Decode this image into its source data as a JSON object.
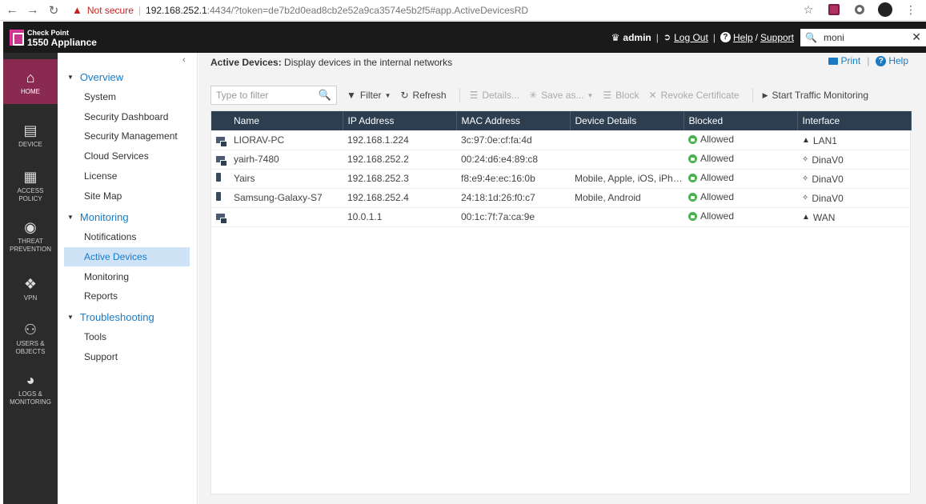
{
  "browser": {
    "security_label": "Not secure",
    "url_host": "192.168.252.1",
    "url_rest": ":4434/?token=de7b2d0ead8cb2e52a9ca3574e5b2f5#app.ActiveDevicesRD"
  },
  "header": {
    "brand_top": "Check Point",
    "brand_bottom": "1550 Appliance",
    "user": "admin",
    "logout": "Log Out",
    "help": "Help",
    "slash": "/",
    "support": "Support",
    "search_value": "moni"
  },
  "icon_nav": [
    {
      "label1": "HOME",
      "label2": "",
      "icon": "home-icon"
    },
    {
      "label1": "DEVICE",
      "label2": "",
      "icon": "device-icon"
    },
    {
      "label1": "ACCESS",
      "label2": "POLICY",
      "icon": "grid-icon"
    },
    {
      "label1": "THREAT",
      "label2": "PREVENTION",
      "icon": "shield-icon"
    },
    {
      "label1": "VPN",
      "label2": "",
      "icon": "vpn-icon"
    },
    {
      "label1": "USERS &",
      "label2": "OBJECTS",
      "icon": "users-icon"
    },
    {
      "label1": "LOGS &",
      "label2": "MONITORING",
      "icon": "gauge-icon"
    }
  ],
  "tree": {
    "overview": "Overview",
    "overview_items": [
      "System",
      "Security Dashboard",
      "Security Management",
      "Cloud Services",
      "License",
      "Site Map"
    ],
    "monitoring": "Monitoring",
    "monitoring_items": [
      "Notifications",
      "Active Devices",
      "Monitoring",
      "Reports"
    ],
    "troubleshooting": "Troubleshooting",
    "troubleshooting_items": [
      "Tools",
      "Support"
    ]
  },
  "main": {
    "title_bold": "Active Devices:",
    "title_rest": " Display devices in the internal networks",
    "print": "Print",
    "help": "Help",
    "filter_placeholder": "Type to filter",
    "filter_btn": "Filter",
    "refresh_btn": "Refresh",
    "details_btn": "Details...",
    "saveas_btn": "Save as...",
    "block_btn": "Block",
    "revoke_btn": "Revoke Certificate",
    "start_monitoring_btn": "Start Traffic Monitoring"
  },
  "table": {
    "columns": [
      "Name",
      "IP Address",
      "MAC Address",
      "Device Details",
      "Blocked",
      "Interface"
    ],
    "rows": [
      {
        "type": "pc",
        "name": "LIORAV-PC",
        "ip": "192.168.1.224",
        "mac": "3c:97:0e:cf:fa:4d",
        "details": "",
        "blocked": "Allowed",
        "iface": "LAN1",
        "iface_type": "lan"
      },
      {
        "type": "pc",
        "name": "yairh-7480",
        "ip": "192.168.252.2",
        "mac": "00:24:d6:e4:89:c8",
        "details": "",
        "blocked": "Allowed",
        "iface": "DinaV0",
        "iface_type": "wifi"
      },
      {
        "type": "phone",
        "name": "Yairs",
        "ip": "192.168.252.3",
        "mac": "f8:e9:4e:ec:16:0b",
        "details": "Mobile, Apple, iOS, iPho...",
        "blocked": "Allowed",
        "iface": "DinaV0",
        "iface_type": "wifi"
      },
      {
        "type": "phone",
        "name": "Samsung-Galaxy-S7",
        "ip": "192.168.252.4",
        "mac": "24:18:1d:26:f0:c7",
        "details": "Mobile, Android",
        "blocked": "Allowed",
        "iface": "DinaV0",
        "iface_type": "wifi"
      },
      {
        "type": "pc",
        "name": "",
        "ip": "10.0.1.1",
        "mac": "00:1c:7f:7a:ca:9e",
        "details": "",
        "blocked": "Allowed",
        "iface": "WAN",
        "iface_type": "lan"
      }
    ]
  }
}
